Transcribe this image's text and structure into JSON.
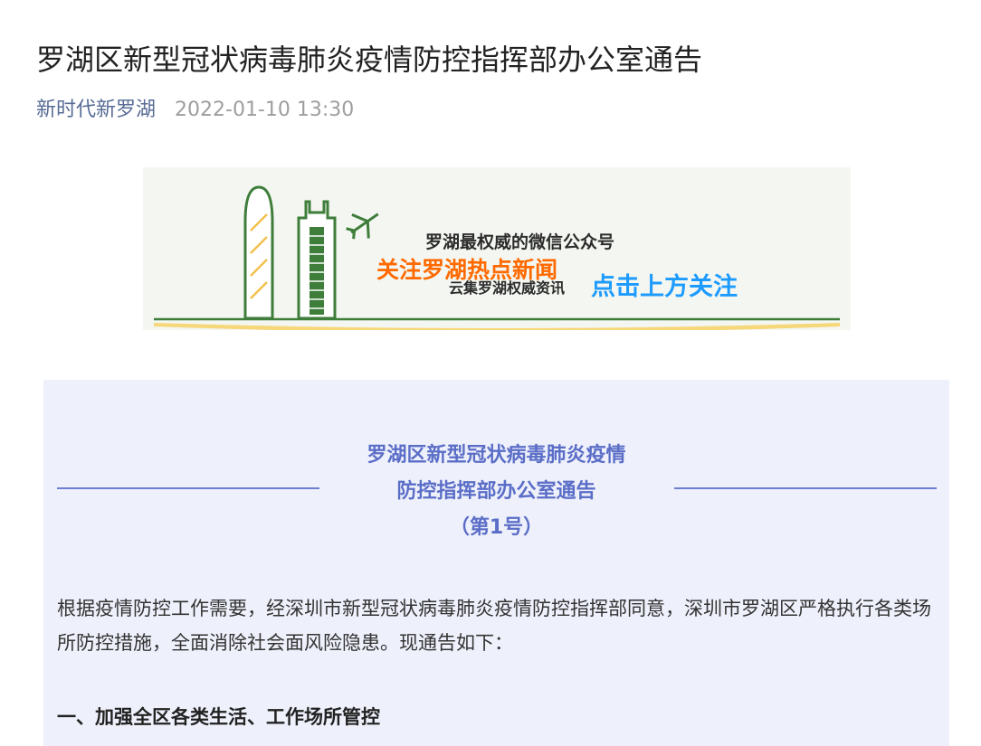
{
  "article": {
    "title": "罗湖区新型冠状病毒肺炎疫情防控指挥部办公室通告",
    "account": "新时代新罗湖",
    "time": "2022-01-10 13:30"
  },
  "banner": {
    "line1": "罗湖最权威的微信公众号",
    "line2": "关注罗湖热点新闻",
    "line3": "云集罗湖权威资讯",
    "cta": "点击上方关注"
  },
  "notice": {
    "heading1": "罗湖区新型冠状病毒肺炎疫情",
    "heading2": "防控指挥部办公室通告",
    "number": "（第1号）",
    "paragraph": "根据疫情防控工作需要，经深圳市新型冠状病毒肺炎疫情防控指挥部同意，深圳市罗湖区严格执行各类场所防控措施，全面消除社会面风险隐患。现通告如下：",
    "section1": "一、加强全区各类生活、工作场所管控"
  },
  "colors": {
    "accent": "#5b6ec7",
    "account_link": "#576b95",
    "banner_orange": "#ff6a00",
    "banner_blue": "#1e9bff",
    "notice_bg": "#eef0fb"
  }
}
